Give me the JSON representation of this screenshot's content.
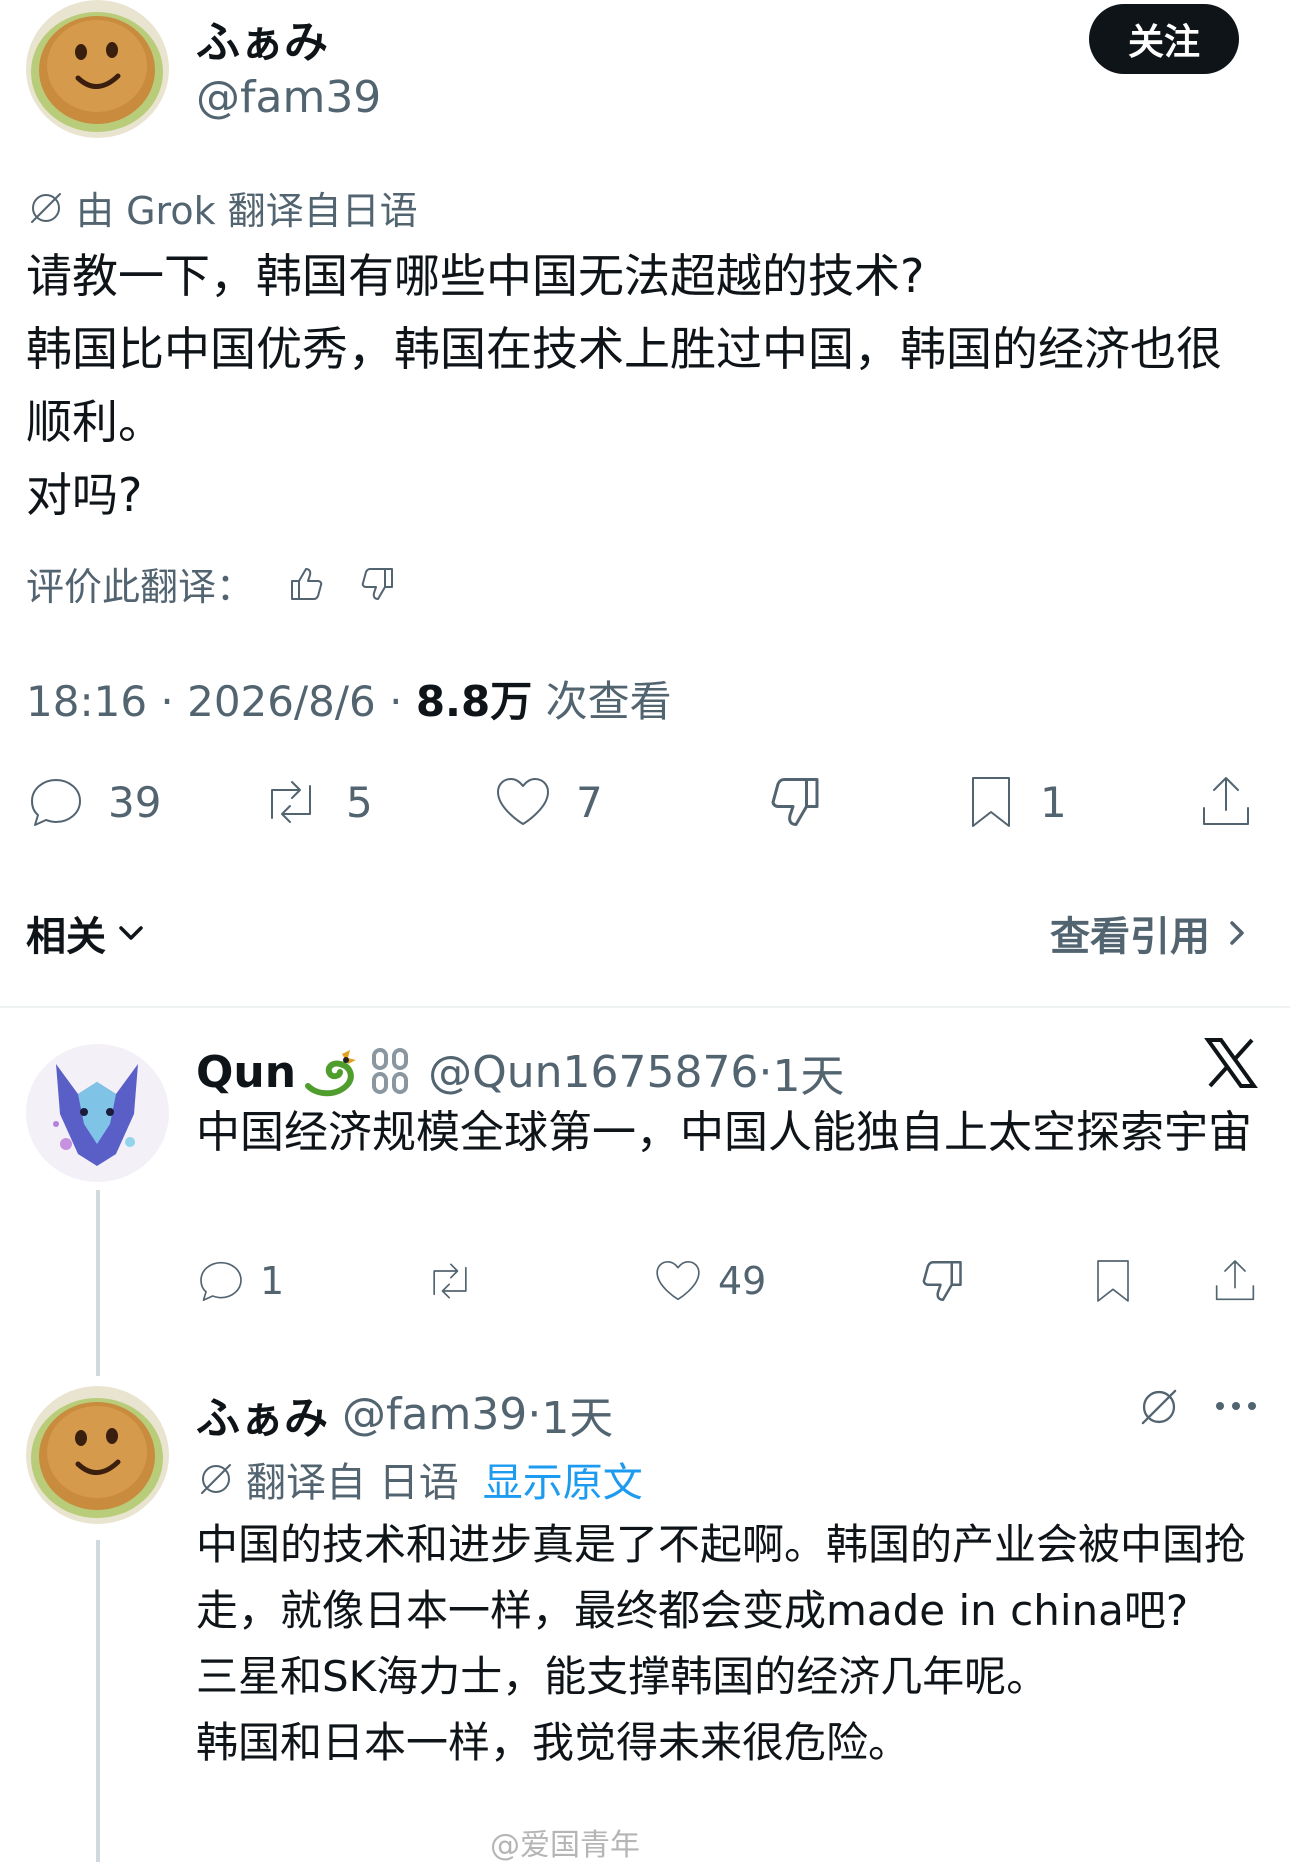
{
  "main_post": {
    "display_name": "ふぁみ",
    "handle": "@fam39",
    "follow_label": "关注",
    "translation_note": "由 Grok 翻译自日语",
    "text": "请教一下，韩国有哪些中国无法超越的技术?\n韩国比中国优秀，韩国在技术上胜过中国，韩国的经济也很顺利。\n对吗?",
    "rate_label": "评价此翻译：",
    "time": "18:16",
    "date": "2026/8/6",
    "views_count": "8.8万",
    "views_label": "次查看",
    "actions": {
      "replies": "39",
      "reposts": "5",
      "likes": "7",
      "bookmarks": "1"
    },
    "related_label": "相关",
    "view_quotes_label": "查看引用"
  },
  "replies": [
    {
      "display_name": "Qun",
      "handle": "@Qun1675876",
      "age": "1天",
      "text": "中国经济规模全球第一，中国人能独自上太空探索宇宙",
      "actions": {
        "replies": "1",
        "likes": "49"
      }
    },
    {
      "display_name": "ふぁみ",
      "handle": "@fam39",
      "age": "1天",
      "translation_note": "翻译自 日语",
      "show_original_label": "显示原文",
      "text": "中国的技术和进步真是了不起啊。韩国的产业会被中国抢走，就像日本一样，最终都会变成made in china吧?\n三星和SK海力士，能支撑韩国的经济几年呢。\n韩国和日本一样，我觉得未来很危险。"
    }
  ],
  "watermark": "@爱国青年"
}
